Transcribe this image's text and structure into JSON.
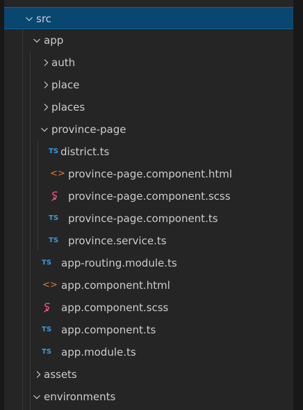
{
  "explorer": {
    "items": [
      {
        "name": "src",
        "kind": "folder-open",
        "selected": true
      },
      {
        "name": "app",
        "kind": "folder-open"
      },
      {
        "name": "auth",
        "kind": "folder-closed"
      },
      {
        "name": "place",
        "kind": "folder-closed"
      },
      {
        "name": "places",
        "kind": "folder-closed"
      },
      {
        "name": "province-page",
        "kind": "folder-open"
      },
      {
        "name": "district.ts",
        "kind": "ts"
      },
      {
        "name": "province-page.component.html",
        "kind": "html"
      },
      {
        "name": "province-page.component.scss",
        "kind": "scss"
      },
      {
        "name": "province-page.component.ts",
        "kind": "ts"
      },
      {
        "name": "province.service.ts",
        "kind": "ts"
      },
      {
        "name": "app-routing.module.ts",
        "kind": "ts"
      },
      {
        "name": "app.component.html",
        "kind": "html"
      },
      {
        "name": "app.component.scss",
        "kind": "scss"
      },
      {
        "name": "app.component.ts",
        "kind": "ts"
      },
      {
        "name": "app.module.ts",
        "kind": "ts"
      },
      {
        "name": "assets",
        "kind": "folder-closed"
      },
      {
        "name": "environments",
        "kind": "folder-open"
      }
    ]
  },
  "icons": {
    "ts_glyph": "TS",
    "html_glyph": "<>"
  },
  "colors": {
    "background": "#252526",
    "selection": "#094771",
    "text": "#cccccc",
    "ts": "#3b9ad9",
    "html": "#e37933",
    "scss": "#f55385"
  }
}
